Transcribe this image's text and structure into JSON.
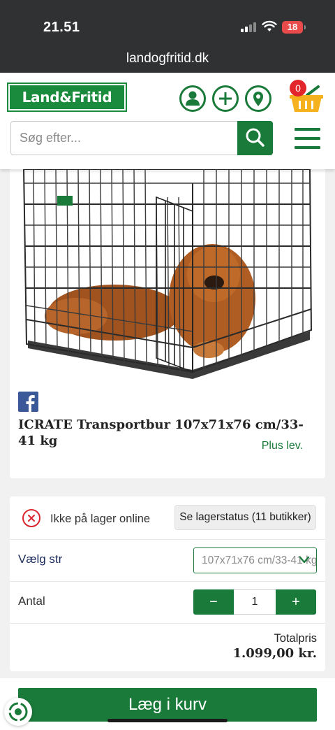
{
  "status_bar": {
    "time": "21.51",
    "battery": "18"
  },
  "browser": {
    "url": "landogfritid.dk"
  },
  "header": {
    "logo_text": "Land&Fritid",
    "cart_count": "0",
    "search_placeholder": "Søg efter..."
  },
  "icons": {
    "account": "user-icon",
    "add": "plus-icon",
    "location": "location-pin-icon",
    "cart": "basket-icon",
    "search": "magnifier-icon",
    "menu": "hamburger-icon",
    "share": "facebook-icon"
  },
  "product": {
    "title": "ICRATE Transportbur 107x71x76 cm/33-41 kg",
    "delivery_note": "Plus lev."
  },
  "options": {
    "stock_status": "Ikke på lager online",
    "stock_button": "Se lagerstatus (11 butikker)",
    "size_label": "Vælg str",
    "size_value": "107x71x76 cm/33-41 kg",
    "quantity_label": "Antal",
    "quantity_minus": "−",
    "quantity_plus": "+",
    "quantity_value": "1",
    "total_label": "Totalpris",
    "total_value": "1.099,00 kr."
  },
  "cta": {
    "add_to_cart": "Læg i kurv"
  },
  "colors": {
    "brand_green": "#1a7a3a",
    "alert_red": "#d9282f",
    "dark_bar": "#2f3133",
    "facebook_blue": "#3b5998"
  }
}
